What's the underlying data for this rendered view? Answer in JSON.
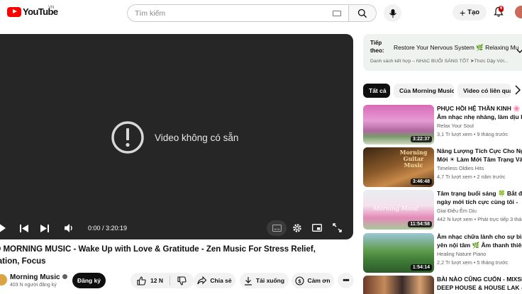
{
  "header": {
    "logo_text": "YouTube",
    "country": "VN",
    "search_placeholder": "Tìm kiếm",
    "create_label": "Tạo",
    "notification_count": "6"
  },
  "player": {
    "unavailable_text": "Video không có sẵn",
    "time": "0:00 / 3:20:19"
  },
  "video": {
    "title_line1": "OD MORNING MUSIC - Wake Up with Love & Gratitude - Zen Music For Stress Relief,",
    "title_line2": "axation, Focus",
    "channel": "Morning Music",
    "subscribers": "403 N người đăng ký",
    "subscribe_label": "Đăng ký",
    "likes": "12 N",
    "share_label": "Chia sẻ",
    "download_label": "Tải xuống",
    "thanks_label": "Cảm ơn"
  },
  "playlist": {
    "next_label": "Tiếp theo:",
    "next_title": "Restore Your Nervous System 🌿 Relaxing Mu...",
    "subtitle": "Danh sách kết hợp – NHẠC BUỔI SÁNG TỐT ➤Thức Dậy Với..."
  },
  "chips": [
    "Tất cả",
    "Của Morning Music",
    "Video có liên quan"
  ],
  "recommendations": [
    {
      "title1": "PHỤC HỒI HỆ THẦN KINH 🌸",
      "title2": "Âm nhạc nhẹ nhàng, làm dịu h...",
      "channel": "Relax Your Soul",
      "meta": "3,1 Tr lượt xem • 9 tháng trước",
      "duration": "3:22:37"
    },
    {
      "title1": "Năng Lượng Tích Cực Cho Ngày",
      "title2": "Mới ☀ Làm Mới Tâm Trạng Và...",
      "channel": "Timeless Oldies Hits",
      "meta": "4,7 Tr lượt xem • 2 năm trước",
      "duration": "3:46:48"
    },
    {
      "title1": "Tâm trạng buổi sáng 🍀 Bắt đầu",
      "title2": "ngày mới tích cực cùng tôi -",
      "channel": "Giai Điệu Êm Dịu",
      "meta": "442 N lượt xem • Phát trực tiếp 3 tháng trước",
      "duration": "11:54:58"
    },
    {
      "title1": "Âm nhạc chữa lành cho sự bình",
      "title2": "yên nội tâm 🌿 Âm thanh thiên...",
      "channel": "Healing Nature Piano",
      "meta": "2,2 Tr lượt xem • 5 tháng trước",
      "duration": "1:54:14"
    },
    {
      "title1": "BÀI NÀO CŨNG CUỐN - MIXSET",
      "title2": "DEEP HOUSE & HOUSE LAK -",
      "channel": "",
      "meta": "",
      "duration": ""
    }
  ],
  "thumb_texts": {
    "rec1": "Morning Guitar Music",
    "rec2": "Morning Mood"
  }
}
